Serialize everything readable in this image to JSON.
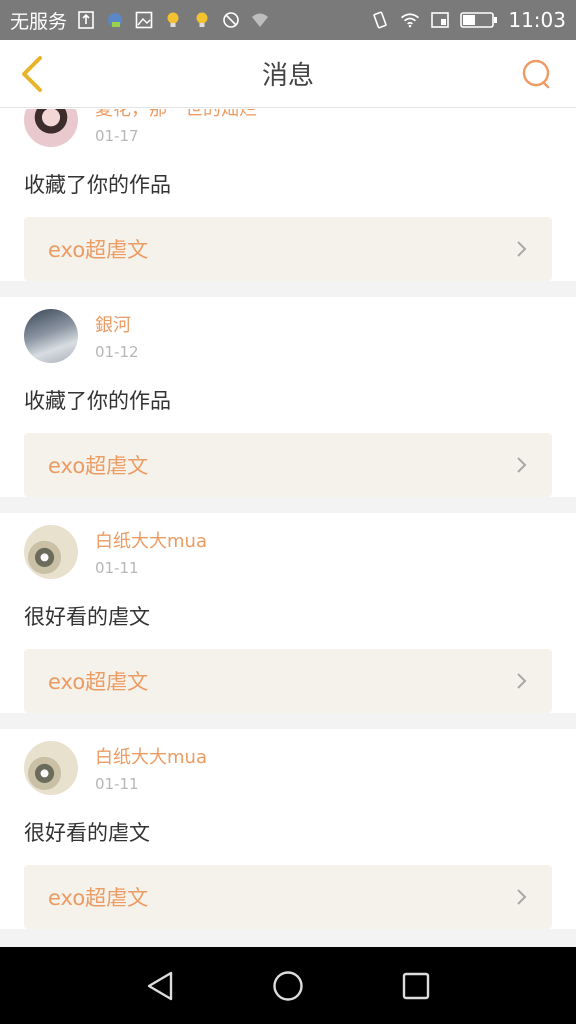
{
  "status_bar": {
    "carrier": "无服务",
    "time": "11:03"
  },
  "header": {
    "title": "消息"
  },
  "messages": [
    {
      "user": "夏花，那一世的灿烂",
      "date": "01-17",
      "action": "收藏了你的作品",
      "work": "exo超虐文"
    },
    {
      "user": "銀河",
      "date": "01-12",
      "action": "收藏了你的作品",
      "work": "exo超虐文"
    },
    {
      "user": "白纸大大mua",
      "date": "01-11",
      "action": "很好看的虐文",
      "work": "exo超虐文"
    },
    {
      "user": "白纸大大mua",
      "date": "01-11",
      "action": "很好看的虐文",
      "work": "exo超虐文"
    }
  ],
  "colors": {
    "accent": "#ec9b62",
    "back_arrow": "#e8b52a",
    "card_bg": "#f4f2ea"
  }
}
